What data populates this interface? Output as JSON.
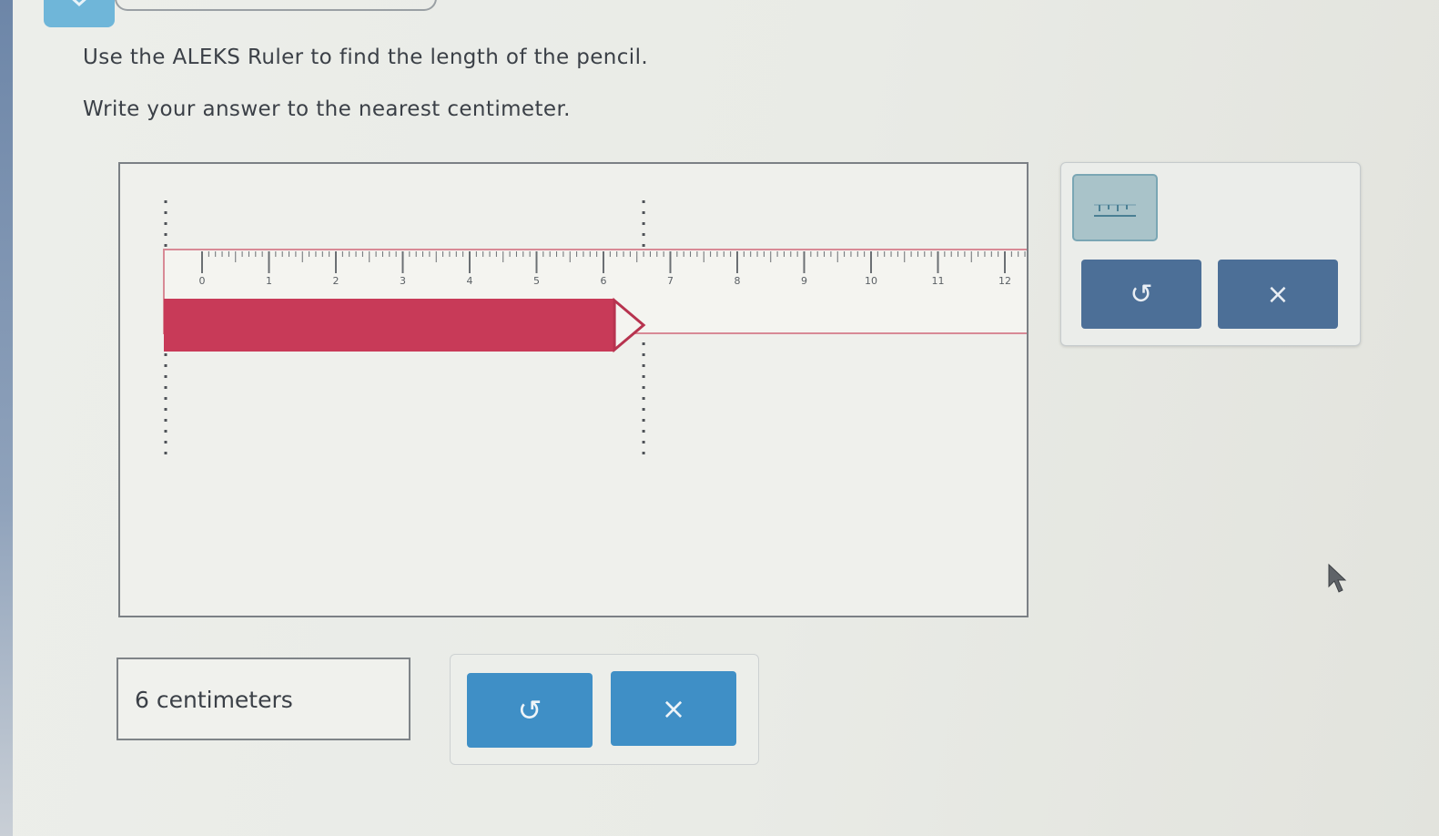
{
  "prompt": {
    "line1": "Use the ALEKS Ruler to find the length of the pencil.",
    "line2": "Write your answer to the nearest centimeter."
  },
  "ruler": {
    "tick_labels": [
      "0",
      "1",
      "2",
      "3",
      "4",
      "5",
      "6",
      "7",
      "8",
      "9",
      "10",
      "11",
      "12"
    ],
    "pencil_length_cm": 6.6,
    "colors": {
      "pencil": "#c83a58",
      "ruler_border": "#d88a96"
    }
  },
  "tools": {
    "ruler_icon": "ruler-icon",
    "undo_label": "↺",
    "clear_label": "×"
  },
  "answer": {
    "value": "6 centimeters",
    "undo_label": "↺",
    "clear_label": "×",
    "button_color": "#3f8fc6"
  }
}
